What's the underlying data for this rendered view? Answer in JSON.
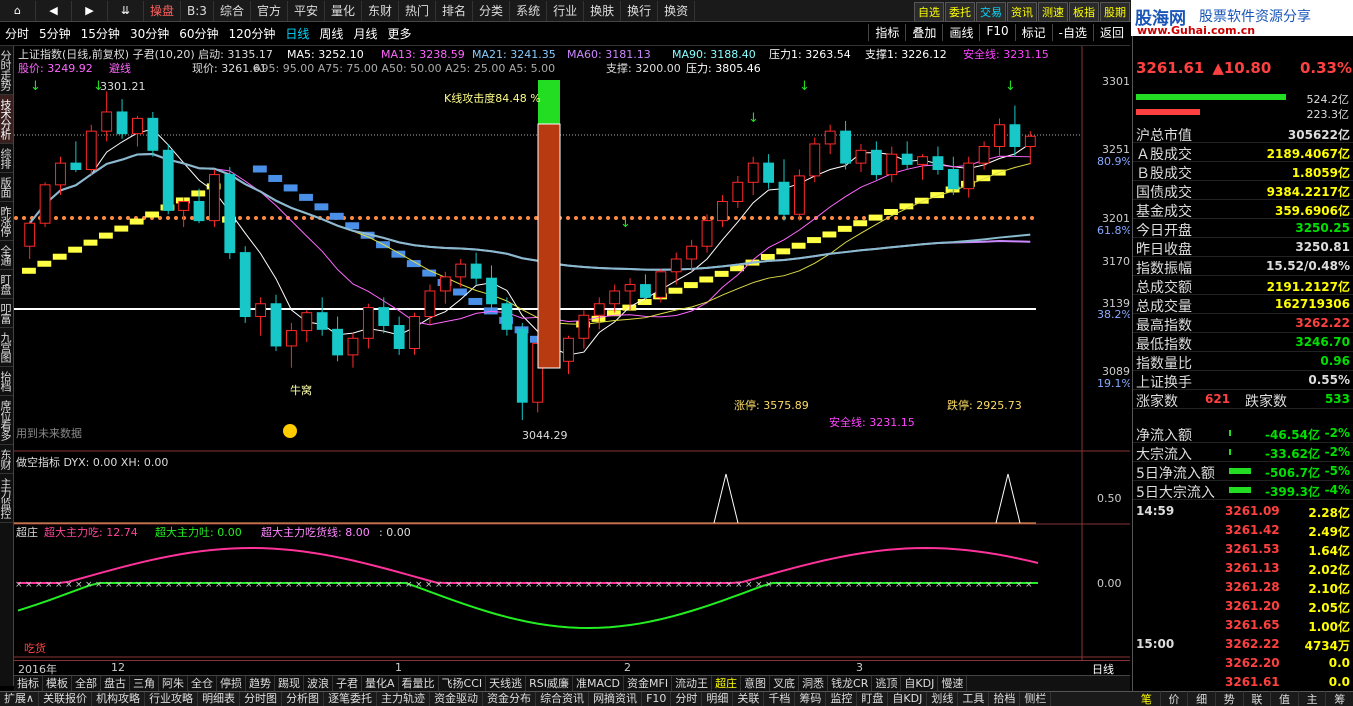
{
  "toolbar": {
    "nav_home": "⌂",
    "nav_back": "◀",
    "nav_fwd": "▶",
    "nav_menu": "⇊",
    "items": [
      "操盘",
      "B:3",
      "综合",
      "官方",
      "平安",
      "量化",
      "东财",
      "热门",
      "排名",
      "分类",
      "系统",
      "行业",
      "换肤",
      "换行",
      "换资"
    ],
    "right_items": [
      "自选",
      "委托",
      "交易",
      "资讯",
      "测速",
      "板指",
      "股期"
    ]
  },
  "brand": {
    "logo": "股海网",
    "slogan": "股票软件资源分享",
    "url": "www.Guhai.com.cn"
  },
  "periods": {
    "items": [
      "分时",
      "5分钟",
      "15分钟",
      "30分钟",
      "60分钟",
      "120分钟",
      "日线",
      "周线",
      "月线",
      "更多"
    ],
    "active": "日线",
    "right": [
      "指标",
      "叠加",
      "画线",
      "F10",
      "标记",
      "-自选",
      "返回"
    ]
  },
  "left_tabs": [
    "分时走势",
    "技术分析",
    "综排",
    "版面",
    "昨涨停",
    "全通",
    "盯盘",
    "叩富",
    "九宫图",
    "抬档",
    "席位看多",
    "东财",
    "主力监控"
  ],
  "chart": {
    "info_line1": "上证指数(日线,前复权) 子君(10,20) 启动: 3135.17",
    "ma5": "MA5: 3252.10",
    "ma13": "MA13: 3238.59",
    "ma21": "MA21: 3241.35",
    "ma60": "MA60: 3181.13",
    "ma90": "MA90: 3188.40",
    "pressure1": "压力1: 3263.54",
    "support1": "支撑1: 3226.12",
    "safeline": "安全线: 3231.15",
    "info2_price": "股价: 3249.92",
    "info2_tag": "避线",
    "info2_now": "现价: 3261.61",
    "info2_a": "A95: 95.00  A75: 75.00  A50: 50.00  A25: 25.00  A5: 5.00",
    "info2_support": "支撑: 3200.00",
    "info2_pressure": "压力: 3805.46",
    "attack": "K线攻击度84.48 %",
    "hi_label": "3301.21",
    "lo_label": "3044.29",
    "cattle": "牛窝",
    "future_hint": "用到未来数据",
    "limit_up": "涨停: 3575.89",
    "limit_down": "跌停: 2925.73",
    "safe_bottom": "安全线: 3231.15",
    "y_axis": [
      "3301",
      "3251",
      "3201",
      "3170",
      "3139",
      "3089"
    ],
    "y_pct": [
      "80.9%",
      "61.8%",
      "38.2%",
      "19.1%"
    ],
    "panel2_title": "做空指标  DYX: 0.00  XH: 0.00",
    "panel2_y": "0.50",
    "panel3_name": "超庄",
    "panel3_a": "超大主力吃: 12.74",
    "panel3_b": "超大主力吐: 0.00",
    "panel3_c": "超大主力吃货线: 8.00",
    "panel3_d": ": 0.00",
    "panel3_y": "0.00",
    "panel3_tag": "吃货",
    "x_labels": [
      "2016年",
      "12",
      "1",
      "2",
      "3"
    ],
    "x_right": "日线"
  },
  "chart_data": {
    "type": "candlestick",
    "title": "上证指数(日线,前复权)",
    "ylim": [
      3030,
      3310
    ],
    "candles": [
      [
        3180,
        3200,
        3170,
        3198
      ],
      [
        3198,
        3230,
        3195,
        3228
      ],
      [
        3228,
        3250,
        3220,
        3245
      ],
      [
        3245,
        3262,
        3238,
        3240
      ],
      [
        3240,
        3275,
        3236,
        3270
      ],
      [
        3270,
        3301,
        3262,
        3285
      ],
      [
        3285,
        3295,
        3264,
        3268
      ],
      [
        3268,
        3282,
        3258,
        3280
      ],
      [
        3280,
        3285,
        3250,
        3255
      ],
      [
        3255,
        3260,
        3205,
        3208
      ],
      [
        3208,
        3218,
        3195,
        3215
      ],
      [
        3215,
        3225,
        3198,
        3200
      ],
      [
        3200,
        3240,
        3195,
        3236
      ],
      [
        3236,
        3242,
        3170,
        3175
      ],
      [
        3175,
        3180,
        3120,
        3125
      ],
      [
        3125,
        3140,
        3110,
        3135
      ],
      [
        3135,
        3142,
        3098,
        3102
      ],
      [
        3102,
        3120,
        3085,
        3114
      ],
      [
        3114,
        3130,
        3105,
        3128
      ],
      [
        3128,
        3140,
        3110,
        3115
      ],
      [
        3115,
        3125,
        3090,
        3095
      ],
      [
        3095,
        3112,
        3085,
        3108
      ],
      [
        3108,
        3135,
        3100,
        3132
      ],
      [
        3132,
        3140,
        3112,
        3118
      ],
      [
        3118,
        3125,
        3095,
        3100
      ],
      [
        3100,
        3128,
        3095,
        3125
      ],
      [
        3125,
        3150,
        3118,
        3145
      ],
      [
        3145,
        3160,
        3135,
        3156
      ],
      [
        3156,
        3170,
        3148,
        3166
      ],
      [
        3166,
        3175,
        3150,
        3155
      ],
      [
        3155,
        3165,
        3130,
        3135
      ],
      [
        3135,
        3140,
        3110,
        3115
      ],
      [
        3115,
        3120,
        3044,
        3058
      ],
      [
        3058,
        3110,
        3050,
        3104
      ],
      [
        3104,
        3120,
        3085,
        3090
      ],
      [
        3090,
        3110,
        3080,
        3108
      ],
      [
        3108,
        3130,
        3100,
        3126
      ],
      [
        3126,
        3140,
        3115,
        3135
      ],
      [
        3135,
        3150,
        3128,
        3145
      ],
      [
        3145,
        3155,
        3130,
        3150
      ],
      [
        3150,
        3158,
        3138,
        3140
      ],
      [
        3140,
        3162,
        3136,
        3160
      ],
      [
        3160,
        3175,
        3150,
        3170
      ],
      [
        3170,
        3185,
        3160,
        3180
      ],
      [
        3180,
        3205,
        3175,
        3200
      ],
      [
        3200,
        3220,
        3195,
        3215
      ],
      [
        3215,
        3235,
        3210,
        3230
      ],
      [
        3230,
        3250,
        3220,
        3245
      ],
      [
        3245,
        3252,
        3225,
        3230
      ],
      [
        3230,
        3248,
        3200,
        3205
      ],
      [
        3205,
        3240,
        3200,
        3235
      ],
      [
        3235,
        3265,
        3230,
        3260
      ],
      [
        3260,
        3275,
        3252,
        3270
      ],
      [
        3270,
        3278,
        3240,
        3245
      ],
      [
        3245,
        3260,
        3238,
        3255
      ],
      [
        3255,
        3262,
        3232,
        3236
      ],
      [
        3236,
        3258,
        3230,
        3252
      ],
      [
        3252,
        3262,
        3240,
        3244
      ],
      [
        3244,
        3252,
        3232,
        3250
      ],
      [
        3250,
        3258,
        3236,
        3240
      ],
      [
        3240,
        3250,
        3220,
        3225
      ],
      [
        3225,
        3250,
        3218,
        3245
      ],
      [
        3245,
        3262,
        3240,
        3258
      ],
      [
        3258,
        3280,
        3250,
        3275
      ],
      [
        3275,
        3290,
        3250,
        3258
      ],
      [
        3258,
        3270,
        3244,
        3266
      ]
    ]
  },
  "right_panel": {
    "price": "3261.61",
    "change": "▲10.80",
    "pct": "0.33%",
    "bar1": "524.2亿",
    "bar2": "223.3亿",
    "rows": [
      {
        "label": "沪总市值",
        "value": "305622亿",
        "color": "white"
      },
      {
        "label": "Ａ股成交",
        "value": "2189.4067亿",
        "color": "yellow"
      },
      {
        "label": "Ｂ股成交",
        "value": "1.8059亿",
        "color": "yellow"
      },
      {
        "label": "国债成交",
        "value": "9384.2217亿",
        "color": "yellow"
      },
      {
        "label": "基金成交",
        "value": "359.6906亿",
        "color": "yellow"
      },
      {
        "label": "今日开盘",
        "value": "3250.25",
        "color": "green"
      },
      {
        "label": "昨日收盘",
        "value": "3250.81",
        "color": "white"
      },
      {
        "label": "指数振幅",
        "value": "15.52/0.48%",
        "color": "white"
      },
      {
        "label": "总成交额",
        "value": "2191.2127亿",
        "color": "yellow"
      },
      {
        "label": "总成交量",
        "value": "162719306",
        "color": "yellow"
      },
      {
        "label": "最高指数",
        "value": "3262.22",
        "color": "red"
      },
      {
        "label": "最低指数",
        "value": "3246.70",
        "color": "green"
      },
      {
        "label": "指数量比",
        "value": "0.96",
        "color": "green"
      },
      {
        "label": "上证换手",
        "value": "0.55%",
        "color": "white"
      }
    ],
    "up_label": "涨家数",
    "up_value": "621",
    "down_label": "跌家数",
    "down_value": "533",
    "flows": [
      {
        "label": "净流入额",
        "value": "-46.54亿",
        "pct": "-2%"
      },
      {
        "label": "大宗流入",
        "value": "-33.62亿",
        "pct": "-2%"
      },
      {
        "label": "5日净流入额",
        "value": "-506.7亿",
        "pct": "-5%"
      },
      {
        "label": "5日大宗流入",
        "value": "-399.3亿",
        "pct": "-4%"
      }
    ],
    "ticks": [
      {
        "time": "14:59",
        "price": "3261.09",
        "vol": "2.28亿",
        "pc": "red"
      },
      {
        "time": "",
        "price": "3261.42",
        "vol": "2.49亿",
        "pc": "red"
      },
      {
        "time": "",
        "price": "3261.53",
        "vol": "1.64亿",
        "pc": "red"
      },
      {
        "time": "",
        "price": "3261.13",
        "vol": "2.02亿",
        "pc": "red"
      },
      {
        "time": "",
        "price": "3261.28",
        "vol": "2.10亿",
        "pc": "red"
      },
      {
        "time": "",
        "price": "3261.20",
        "vol": "2.05亿",
        "pc": "red"
      },
      {
        "time": "",
        "price": "3261.65",
        "vol": "1.00亿",
        "pc": "red"
      },
      {
        "time": "15:00",
        "price": "3262.22",
        "vol": "4734万",
        "pc": "red"
      },
      {
        "time": "",
        "price": "3262.20",
        "vol": "0.0",
        "pc": "red"
      },
      {
        "time": "",
        "price": "3261.61",
        "vol": "0.0",
        "pc": "red"
      }
    ],
    "tabs": [
      "笔",
      "价",
      "细",
      "势",
      "联",
      "值",
      "主",
      "筹"
    ]
  },
  "ind_tabs": [
    "指标",
    "模板",
    "全部",
    "盘古",
    "三角",
    "阿朱",
    "全仓",
    "停损",
    "趋势",
    "踢现",
    "波浪",
    "子君",
    "量化A",
    "看量比",
    "飞扬CCI",
    "天线逃",
    "RSI威廉",
    "准MACD",
    "资金MFI",
    "流动王",
    "超庄",
    "意图",
    "叉底",
    "洞悉",
    "钱龙CR",
    "逃顶",
    "自KDJ",
    "慢速"
  ],
  "ind_active": "超庄",
  "bottom_bar": [
    "扩展∧",
    "关联报价",
    "机构攻略",
    "行业攻略",
    "明细表",
    "分时图",
    "分析图",
    "逐笔委托",
    "主力轨迹",
    "资金驱动",
    "资金分布",
    "综合资讯",
    "网摘资讯",
    "F10",
    "分时",
    "明细",
    "关联",
    "千档",
    "筹码",
    "监控",
    "盯盘",
    "自KDJ",
    "划线",
    "工具",
    "拾档",
    "侧栏"
  ]
}
